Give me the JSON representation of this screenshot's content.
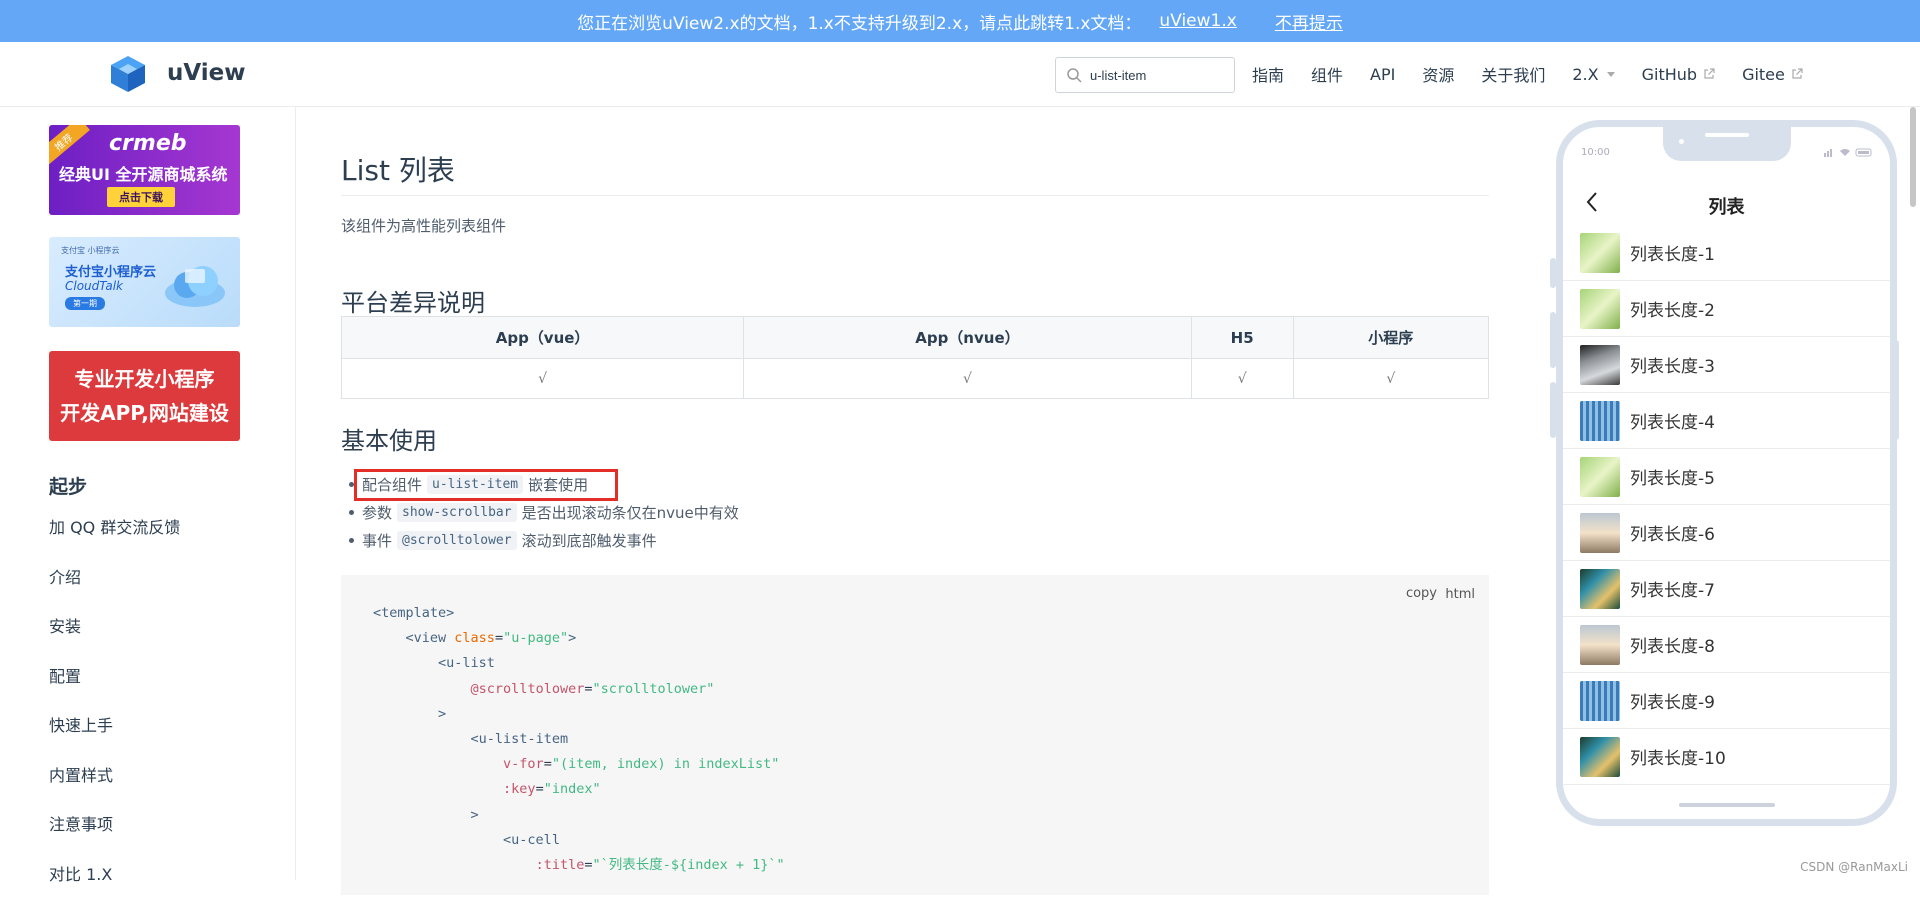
{
  "banner": {
    "text": "您正在浏览uView2.x的文档，1.x不支持升级到2.x，请点此跳转1.x文档：",
    "link": "uView1.x",
    "dismiss": "不再提示"
  },
  "header": {
    "brand": "uView",
    "search_value": "u-list-item",
    "nav": [
      "指南",
      "组件",
      "API",
      "资源",
      "关于我们"
    ],
    "version": "2.X",
    "github": "GitHub",
    "gitee": "Gitee"
  },
  "sidebar": {
    "ad1": {
      "tag": "推荐",
      "logo": "crmeb",
      "line": "经典UI 全开源商城系统",
      "button": "点击下载"
    },
    "ad2": {
      "small": "支付宝 小程序云",
      "line1": "支付宝小程序云",
      "line2": "CloudTalk",
      "pill": "第一期"
    },
    "ad3": {
      "line1": "专业开发小程序",
      "line2": "开发APP,网站建设"
    },
    "section_title": "起步",
    "items": [
      "加 QQ 群交流反馈",
      "介绍",
      "安装",
      "配置",
      "快速上手",
      "内置样式",
      "注意事项",
      "对比 1.X"
    ]
  },
  "content": {
    "title": "List 列表",
    "description": "该组件为高性能列表组件",
    "platform_heading": "平台差异说明",
    "platform_table": {
      "headers": [
        "App（vue）",
        "App（nvue）",
        "H5",
        "小程序"
      ],
      "row": [
        "√",
        "√",
        "√",
        "√"
      ]
    },
    "basic_heading": "基本使用",
    "usage": [
      {
        "pre": "配合组件",
        "code": "u-list-item",
        "post": "嵌套使用"
      },
      {
        "pre": "参数",
        "code": "show-scrollbar",
        "post": "是否出现滚动条仅在nvue中有效"
      },
      {
        "pre": "事件",
        "code": "@scrolltolower",
        "post": "滚动到底部触发事件"
      }
    ],
    "code": {
      "copy": "copy",
      "lang": "html"
    }
  },
  "phone": {
    "time": "10:00",
    "title": "列表",
    "items": [
      "列表长度-1",
      "列表长度-2",
      "列表长度-3",
      "列表长度-4",
      "列表长度-5",
      "列表长度-6",
      "列表长度-7",
      "列表长度-8",
      "列表长度-9",
      "列表长度-10"
    ]
  },
  "watermark": "CSDN @RanMaxLi"
}
